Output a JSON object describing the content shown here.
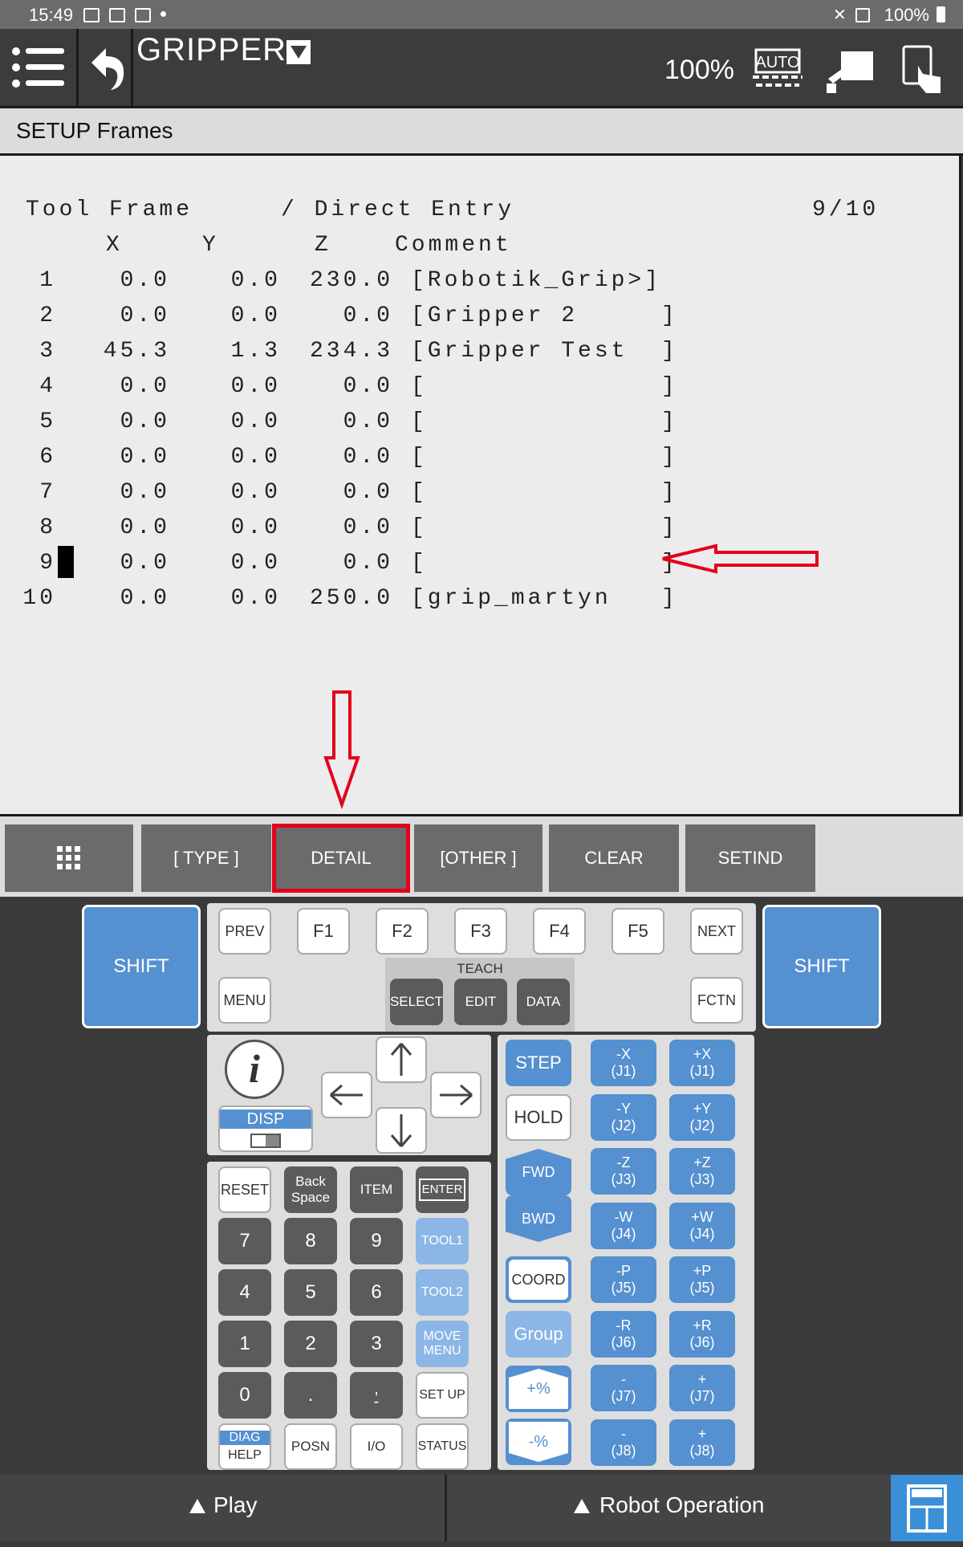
{
  "status_bar": {
    "time": "15:49",
    "battery": "100%"
  },
  "header": {
    "program": "GRIPPER",
    "override": "100%",
    "auto": "AUTO"
  },
  "title_bar": "SETUP Frames",
  "screen": {
    "title_left": "Tool Frame",
    "title_mid": "/ Direct Entry",
    "title_right": "9/10",
    "columns": [
      "X",
      "Y",
      "Z",
      "Comment"
    ],
    "rows": [
      {
        "n": "1",
        "x": "0.0",
        "y": "0.0",
        "z": "230.0",
        "c": "[Robotik_Grip>]"
      },
      {
        "n": "2",
        "x": "0.0",
        "y": "0.0",
        "z": "0.0",
        "c": "[Gripper 2     ]"
      },
      {
        "n": "3",
        "x": "45.3",
        "y": "1.3",
        "z": "234.3",
        "c": "[Gripper Test  ]"
      },
      {
        "n": "4",
        "x": "0.0",
        "y": "0.0",
        "z": "0.0",
        "c": "[              ]"
      },
      {
        "n": "5",
        "x": "0.0",
        "y": "0.0",
        "z": "0.0",
        "c": "[              ]"
      },
      {
        "n": "6",
        "x": "0.0",
        "y": "0.0",
        "z": "0.0",
        "c": "[              ]"
      },
      {
        "n": "7",
        "x": "0.0",
        "y": "0.0",
        "z": "0.0",
        "c": "[              ]"
      },
      {
        "n": "8",
        "x": "0.0",
        "y": "0.0",
        "z": "0.0",
        "c": "[              ]"
      },
      {
        "n": "9",
        "x": "0.0",
        "y": "0.0",
        "z": "0.0",
        "c": "[              ]"
      },
      {
        "n": "10",
        "x": "0.0",
        "y": "0.0",
        "z": "250.0",
        "c": "[grip_martyn   ]"
      }
    ]
  },
  "function_keys": [
    "[ TYPE ]",
    "DETAIL",
    "[OTHER ]",
    "CLEAR",
    "SETIND"
  ],
  "pendant": {
    "shift": "SHIFT",
    "prev": "PREV",
    "next": "NEXT",
    "f": [
      "F1",
      "F2",
      "F3",
      "F4",
      "F5"
    ],
    "menu": "MENU",
    "fctn": "FCTN",
    "teach": "TEACH",
    "select": "SELECT",
    "edit": "EDIT",
    "data": "DATA",
    "disp": "DISP",
    "reset": "RESET",
    "backspace": "Back Space",
    "item": "ITEM",
    "enter": "ENTER",
    "nums": [
      "7",
      "8",
      "9",
      "4",
      "5",
      "6",
      "1",
      "2",
      "3",
      "0",
      ".",
      ",\n-"
    ],
    "tool1": "TOOL1",
    "tool2": "TOOL2",
    "move_menu": "MOVE MENU",
    "setup": "SET UP",
    "diag": "DIAG",
    "help": "HELP",
    "posn": "POSN",
    "io": "I/O",
    "status": "STATUS",
    "step": "STEP",
    "hold": "HOLD",
    "fwd": "FWD",
    "bwd": "BWD",
    "coord": "COORD",
    "group": "Group",
    "plus_pct": "+%",
    "minus_pct": "-%",
    "jog_neg": [
      "-X\n(J1)",
      "-Y\n(J2)",
      "-Z\n(J3)",
      "-W\n(J4)",
      "-P\n(J5)",
      "-R\n(J6)",
      "-\n(J7)",
      "-\n(J8)"
    ],
    "jog_pos": [
      "+X\n(J1)",
      "+Y\n(J2)",
      "+Z\n(J3)",
      "+W\n(J4)",
      "+P\n(J5)",
      "+R\n(J6)",
      "+\n(J7)",
      "+\n(J8)"
    ]
  },
  "bottom": {
    "play": "Play",
    "robot_operation": "Robot Operation"
  },
  "colors": {
    "annotation": "#e3001b",
    "key_blue": "#5590d0"
  }
}
